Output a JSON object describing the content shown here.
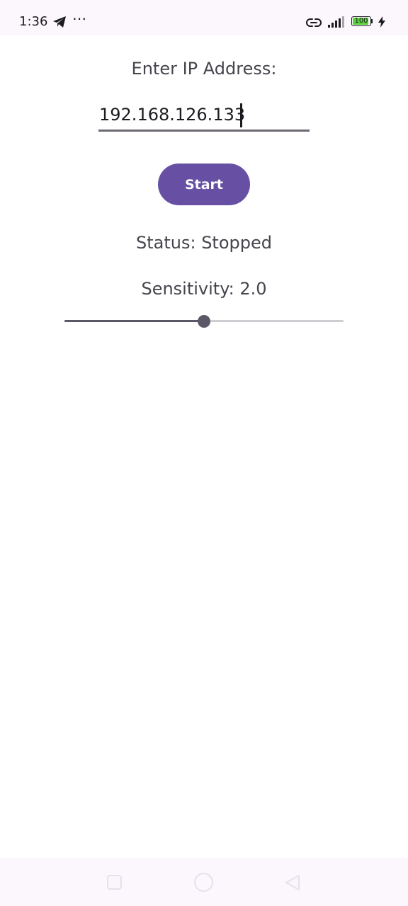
{
  "status_bar": {
    "time": "1:36",
    "battery_level": "100",
    "battery_color": "#5bd23a"
  },
  "ip_section": {
    "label": "Enter IP Address:",
    "value": "192.168.126.133"
  },
  "start_button": {
    "label": "Start",
    "color": "#6750a4"
  },
  "status": {
    "text": "Status: Stopped"
  },
  "sensitivity": {
    "text": "Sensitivity: 2.0",
    "slider_fraction": 0.5
  },
  "icons": {
    "status_bar": [
      "telegram-icon",
      "more-dots-icon",
      "link-icon",
      "signal-icon",
      "battery-icon",
      "charging-icon"
    ],
    "nav_bar": [
      "recents-square-icon",
      "home-circle-icon",
      "back-triangle-icon"
    ]
  }
}
